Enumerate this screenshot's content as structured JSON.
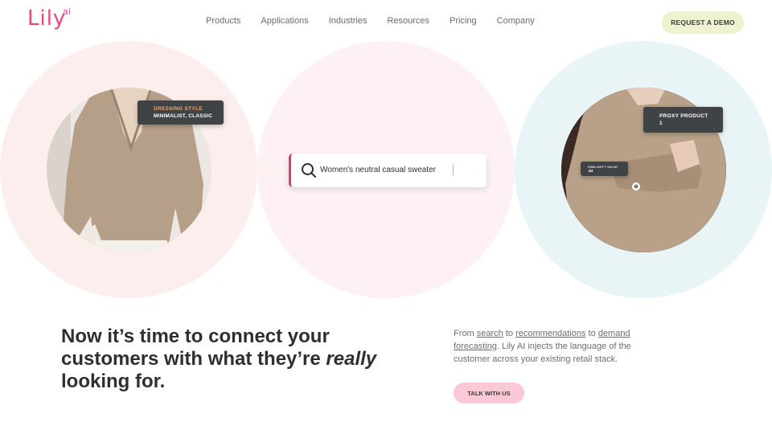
{
  "brand": {
    "logo": "Lily",
    "logo_sup": "ai",
    "accent": "#e8477a"
  },
  "nav": {
    "items": [
      "Products",
      "Applications",
      "Industries",
      "Resources",
      "Pricing",
      "Company"
    ],
    "cta": "REQUEST A DEMO"
  },
  "hero": {
    "left_tag": {
      "title": "DRESSING STYLE",
      "value": "MINIMALIST, CLASSIC"
    },
    "search": {
      "query": "Women's neutral casual sweater"
    },
    "right_tag": {
      "title": "PROXY PRODUCT",
      "value": "1"
    },
    "similarity_tag": {
      "title": "SIMILARITY VALUE",
      "value": ".84"
    }
  },
  "content": {
    "headline_1": "Now it’s time to connect your customers with what they’re ",
    "headline_em": "really",
    "headline_2": " looking for.",
    "desc": {
      "from": "From ",
      "link_search": "search",
      "to1": " to ",
      "link_reco": "recommendations",
      "to2": " to ",
      "link_demand": "demand forecasting",
      "rest": ". Lily AI injects the language of the customer across your existing retail stack."
    },
    "cta": "TALK WITH US"
  }
}
